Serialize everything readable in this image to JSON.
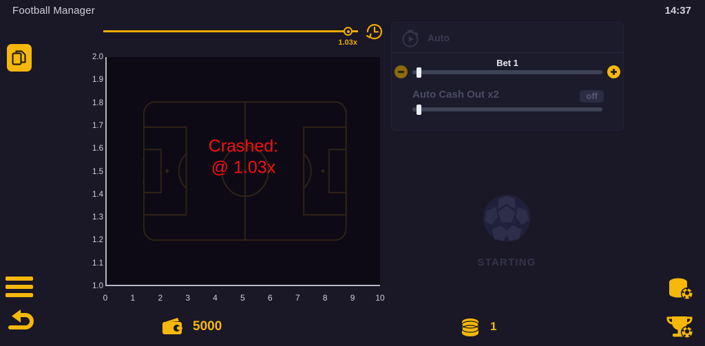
{
  "header": {
    "title": "Football Manager",
    "time": "14:37"
  },
  "left_rail": {
    "copy_icon": "copy-documents-icon",
    "menu_icon": "hamburger-menu-icon",
    "back_icon": "back-arrow-icon"
  },
  "multiplier_track": {
    "value_label": "1.03x",
    "progress_percent": 96,
    "history_icon": "history-clock-icon",
    "track_color": "#f0ab00"
  },
  "chart_data": {
    "type": "line",
    "title": "",
    "xlabel": "",
    "ylabel": "",
    "x": [],
    "values": [],
    "xlim": [
      0,
      10
    ],
    "ylim": [
      1.0,
      2.0
    ],
    "xticks": [
      "0",
      "1",
      "2",
      "3",
      "4",
      "5",
      "6",
      "7",
      "8",
      "9",
      "10"
    ],
    "yticks": [
      "1.0",
      "1.1",
      "1.2",
      "1.3",
      "1.4",
      "1.5",
      "1.6",
      "1.7",
      "1.8",
      "1.9",
      "2.0"
    ],
    "grid": false,
    "legend": "none",
    "annotation_line1": "Crashed:",
    "annotation_line2": "@ 1.03x",
    "annotation_color": "#f51010",
    "background": "#0d0a16",
    "watermark": "football-pitch"
  },
  "bet_panel": {
    "auto_label": "Auto",
    "auto_icon": "stopwatch-play-icon",
    "bet_title": "Bet 1",
    "minus_label": "−",
    "plus_label": "+",
    "bet_slider_percent": 2,
    "auto_cashout_label": "Auto Cash Out x2",
    "auto_cashout_state": "off",
    "cashout_slider_percent": 2
  },
  "status": {
    "ball_icon": "football-icon",
    "text": "STARTING"
  },
  "bottom_bar": {
    "wallet_icon": "wallet-icon",
    "wallet_amount": "5000",
    "coins_icon": "coins-stack-icon",
    "coins_amount": "1"
  },
  "right_rail": {
    "coins_ball_icon": "coins-football-icon",
    "trophy_ball_icon": "trophy-football-icon"
  }
}
